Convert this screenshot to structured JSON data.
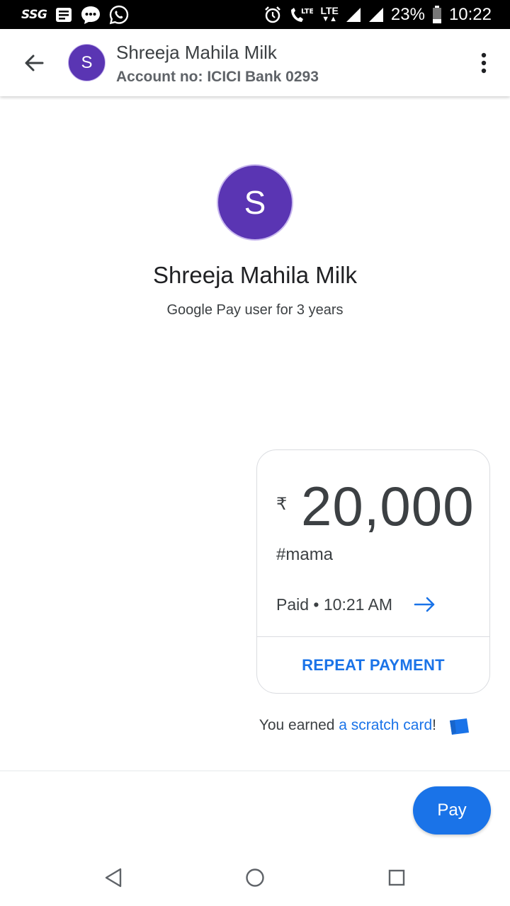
{
  "status_bar": {
    "carrier": "SSG",
    "lte1": "LTE",
    "lte2": "LTE",
    "battery": "23%",
    "time": "10:22",
    "icons": [
      "notes-icon",
      "messages-icon",
      "whatsapp-icon",
      "alarm-icon",
      "volte-icon",
      "lte-data-icon",
      "signal-icon",
      "battery-icon"
    ]
  },
  "header": {
    "avatar_letter": "S",
    "title": "Shreeja Mahila Milk",
    "subtitle": "Account no: ICICI Bank 0293"
  },
  "profile": {
    "avatar_letter": "S",
    "name": "Shreeja Mahila Milk",
    "tenure": "Google Pay user for 3 years"
  },
  "payment": {
    "currency": "₹",
    "amount": "20,000",
    "note": "#mama",
    "status": "Paid • 10:21 AM",
    "repeat_label": "REPEAT PAYMENT"
  },
  "reward": {
    "prefix": "You earned ",
    "link": "a scratch card",
    "suffix": "!"
  },
  "footer": {
    "pay_label": "Pay"
  },
  "colors": {
    "avatar": "#5a35b3",
    "accent": "#1a73e8",
    "text_primary": "#3c4043"
  }
}
